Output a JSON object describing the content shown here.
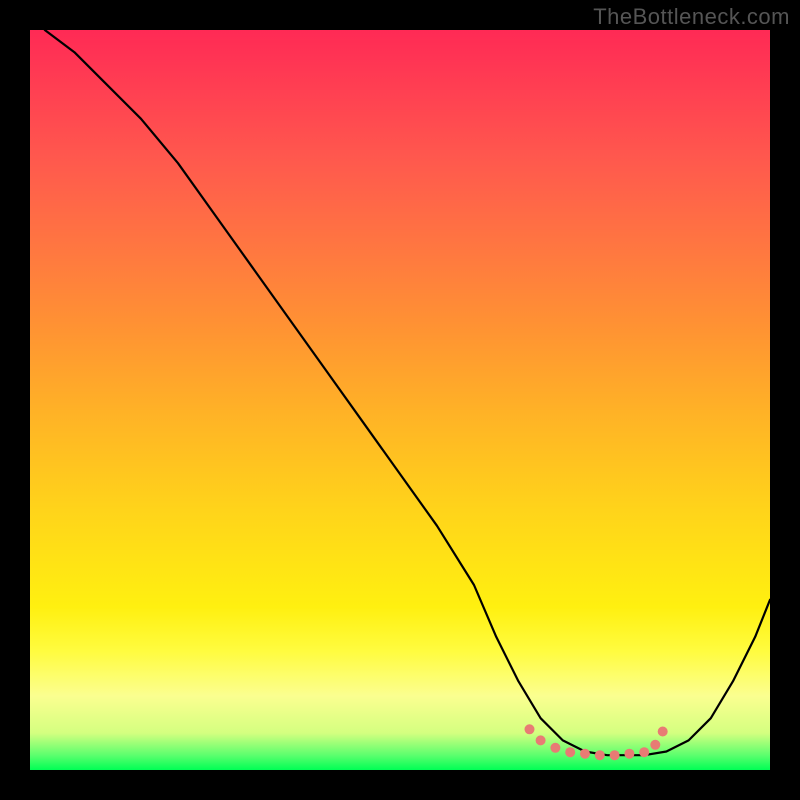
{
  "watermark": "TheBottleneck.com",
  "chart_data": {
    "type": "line",
    "title": "",
    "xlabel": "",
    "ylabel": "",
    "xlim": [
      0,
      100
    ],
    "ylim": [
      0,
      100
    ],
    "series": [
      {
        "name": "bottleneck-curve",
        "x": [
          2,
          6,
          10,
          15,
          20,
          25,
          30,
          35,
          40,
          45,
          50,
          55,
          60,
          63,
          66,
          69,
          72,
          75,
          78,
          80,
          83,
          86,
          89,
          92,
          95,
          98,
          100
        ],
        "y": [
          100,
          97,
          93,
          88,
          82,
          75,
          68,
          61,
          54,
          47,
          40,
          33,
          25,
          18,
          12,
          7,
          4,
          2.5,
          2,
          2,
          2,
          2.5,
          4,
          7,
          12,
          18,
          23
        ]
      }
    ],
    "markers": {
      "name": "optimal-zone-points",
      "x": [
        67.5,
        69,
        71,
        73,
        75,
        77,
        79,
        81,
        83,
        84.5,
        85.5
      ],
      "y": [
        5.5,
        4,
        3,
        2.4,
        2.2,
        2,
        2,
        2.2,
        2.4,
        3.4,
        5.2
      ]
    },
    "gradient_stops": [
      {
        "pos": 0,
        "color": "#ff2a55"
      },
      {
        "pos": 50,
        "color": "#ffb326"
      },
      {
        "pos": 80,
        "color": "#fff010"
      },
      {
        "pos": 100,
        "color": "#00ff55"
      }
    ]
  }
}
